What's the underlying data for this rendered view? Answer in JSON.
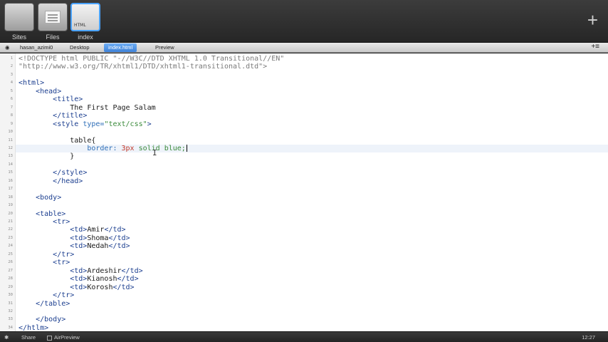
{
  "toolbar": {
    "tools": [
      {
        "label": "Sites"
      },
      {
        "label": "Files"
      },
      {
        "label": "index",
        "thumb_text": "HTML"
      }
    ],
    "add_icon": "plus-icon"
  },
  "tabbar": {
    "eye_icon": "◉",
    "user": "hasan_azimi0",
    "desktop": "Desktop",
    "file": "index.html",
    "preview": "Preview",
    "menu_icon": "+≡"
  },
  "editor": {
    "current_line": 12,
    "line_numbers": [
      "1",
      "2",
      "3",
      "4",
      "5",
      "6",
      "7",
      "8",
      "9",
      "10",
      "11",
      "12",
      "13",
      "14",
      "15",
      "16",
      "17",
      "18",
      "19",
      "20",
      "21",
      "22",
      "23",
      "24",
      "25",
      "26",
      "27",
      "28",
      "29",
      "30",
      "31",
      "32",
      "33",
      "34"
    ],
    "lines": [
      {
        "indent": "",
        "segs": [
          {
            "c": "doctype",
            "t": "<!DOCTYPE html PUBLIC \"-//W3C//DTD XHTML 1.0 Transitional//EN\""
          }
        ]
      },
      {
        "indent": "",
        "segs": [
          {
            "c": "doctype",
            "t": "\"http://www.w3.org/TR/xhtml1/DTD/xhtml1-transitional.dtd\">"
          }
        ]
      },
      {
        "indent": "",
        "segs": []
      },
      {
        "indent": "",
        "segs": [
          {
            "c": "tag",
            "t": "<html>"
          }
        ]
      },
      {
        "indent": "    ",
        "segs": [
          {
            "c": "tag",
            "t": "<head>"
          }
        ]
      },
      {
        "indent": "        ",
        "segs": [
          {
            "c": "tag",
            "t": "<title>"
          }
        ]
      },
      {
        "indent": "            ",
        "segs": [
          {
            "c": "",
            "t": "The First Page Salam"
          }
        ]
      },
      {
        "indent": "        ",
        "segs": [
          {
            "c": "tag",
            "t": "</title>"
          }
        ]
      },
      {
        "indent": "        ",
        "segs": [
          {
            "c": "tag",
            "t": "<style "
          },
          {
            "c": "attr",
            "t": "type="
          },
          {
            "c": "str",
            "t": "\"text/css\""
          },
          {
            "c": "tag",
            "t": ">"
          }
        ]
      },
      {
        "indent": "",
        "segs": []
      },
      {
        "indent": "            ",
        "segs": [
          {
            "c": "",
            "t": "table{"
          }
        ]
      },
      {
        "indent": "                ",
        "segs": [
          {
            "c": "prop",
            "t": "border: "
          },
          {
            "c": "num",
            "t": "3px"
          },
          {
            "c": "val",
            "t": " solid blue;"
          }
        ]
      },
      {
        "indent": "            ",
        "segs": [
          {
            "c": "",
            "t": "}"
          }
        ]
      },
      {
        "indent": "",
        "segs": []
      },
      {
        "indent": "        ",
        "segs": [
          {
            "c": "tag",
            "t": "</style>"
          }
        ]
      },
      {
        "indent": "        ",
        "segs": [
          {
            "c": "tag",
            "t": "</head>"
          }
        ]
      },
      {
        "indent": "",
        "segs": []
      },
      {
        "indent": "    ",
        "segs": [
          {
            "c": "tag",
            "t": "<body>"
          }
        ]
      },
      {
        "indent": "",
        "segs": []
      },
      {
        "indent": "    ",
        "segs": [
          {
            "c": "tag",
            "t": "<table>"
          }
        ]
      },
      {
        "indent": "        ",
        "segs": [
          {
            "c": "tag",
            "t": "<tr>"
          }
        ]
      },
      {
        "indent": "            ",
        "segs": [
          {
            "c": "tag",
            "t": "<td>"
          },
          {
            "c": "",
            "t": "Amir"
          },
          {
            "c": "tag",
            "t": "</td>"
          }
        ]
      },
      {
        "indent": "            ",
        "segs": [
          {
            "c": "tag",
            "t": "<td>"
          },
          {
            "c": "",
            "t": "Shoma"
          },
          {
            "c": "tag",
            "t": "</td>"
          }
        ]
      },
      {
        "indent": "            ",
        "segs": [
          {
            "c": "tag",
            "t": "<td>"
          },
          {
            "c": "",
            "t": "Nedah"
          },
          {
            "c": "tag",
            "t": "</td>"
          }
        ]
      },
      {
        "indent": "        ",
        "segs": [
          {
            "c": "tag",
            "t": "</tr>"
          }
        ]
      },
      {
        "indent": "        ",
        "segs": [
          {
            "c": "tag",
            "t": "<tr>"
          }
        ]
      },
      {
        "indent": "            ",
        "segs": [
          {
            "c": "tag",
            "t": "<td>"
          },
          {
            "c": "",
            "t": "Ardeshir"
          },
          {
            "c": "tag",
            "t": "</td>"
          }
        ]
      },
      {
        "indent": "            ",
        "segs": [
          {
            "c": "tag",
            "t": "<td>"
          },
          {
            "c": "",
            "t": "Kianosh"
          },
          {
            "c": "tag",
            "t": "</td>"
          }
        ]
      },
      {
        "indent": "            ",
        "segs": [
          {
            "c": "tag",
            "t": "<td>"
          },
          {
            "c": "",
            "t": "Korosh"
          },
          {
            "c": "tag",
            "t": "</td>"
          }
        ]
      },
      {
        "indent": "        ",
        "segs": [
          {
            "c": "tag",
            "t": "</tr>"
          }
        ]
      },
      {
        "indent": "    ",
        "segs": [
          {
            "c": "tag",
            "t": "</table>"
          }
        ]
      },
      {
        "indent": "",
        "segs": []
      },
      {
        "indent": "    ",
        "segs": [
          {
            "c": "tag",
            "t": "</body>"
          }
        ]
      },
      {
        "indent": "",
        "segs": [
          {
            "c": "tag",
            "t": "</htlm>"
          }
        ]
      }
    ]
  },
  "statusbar": {
    "gear_icon": "✱",
    "share": "Share",
    "airpreview": "AirPreview",
    "clock": "12:27"
  }
}
